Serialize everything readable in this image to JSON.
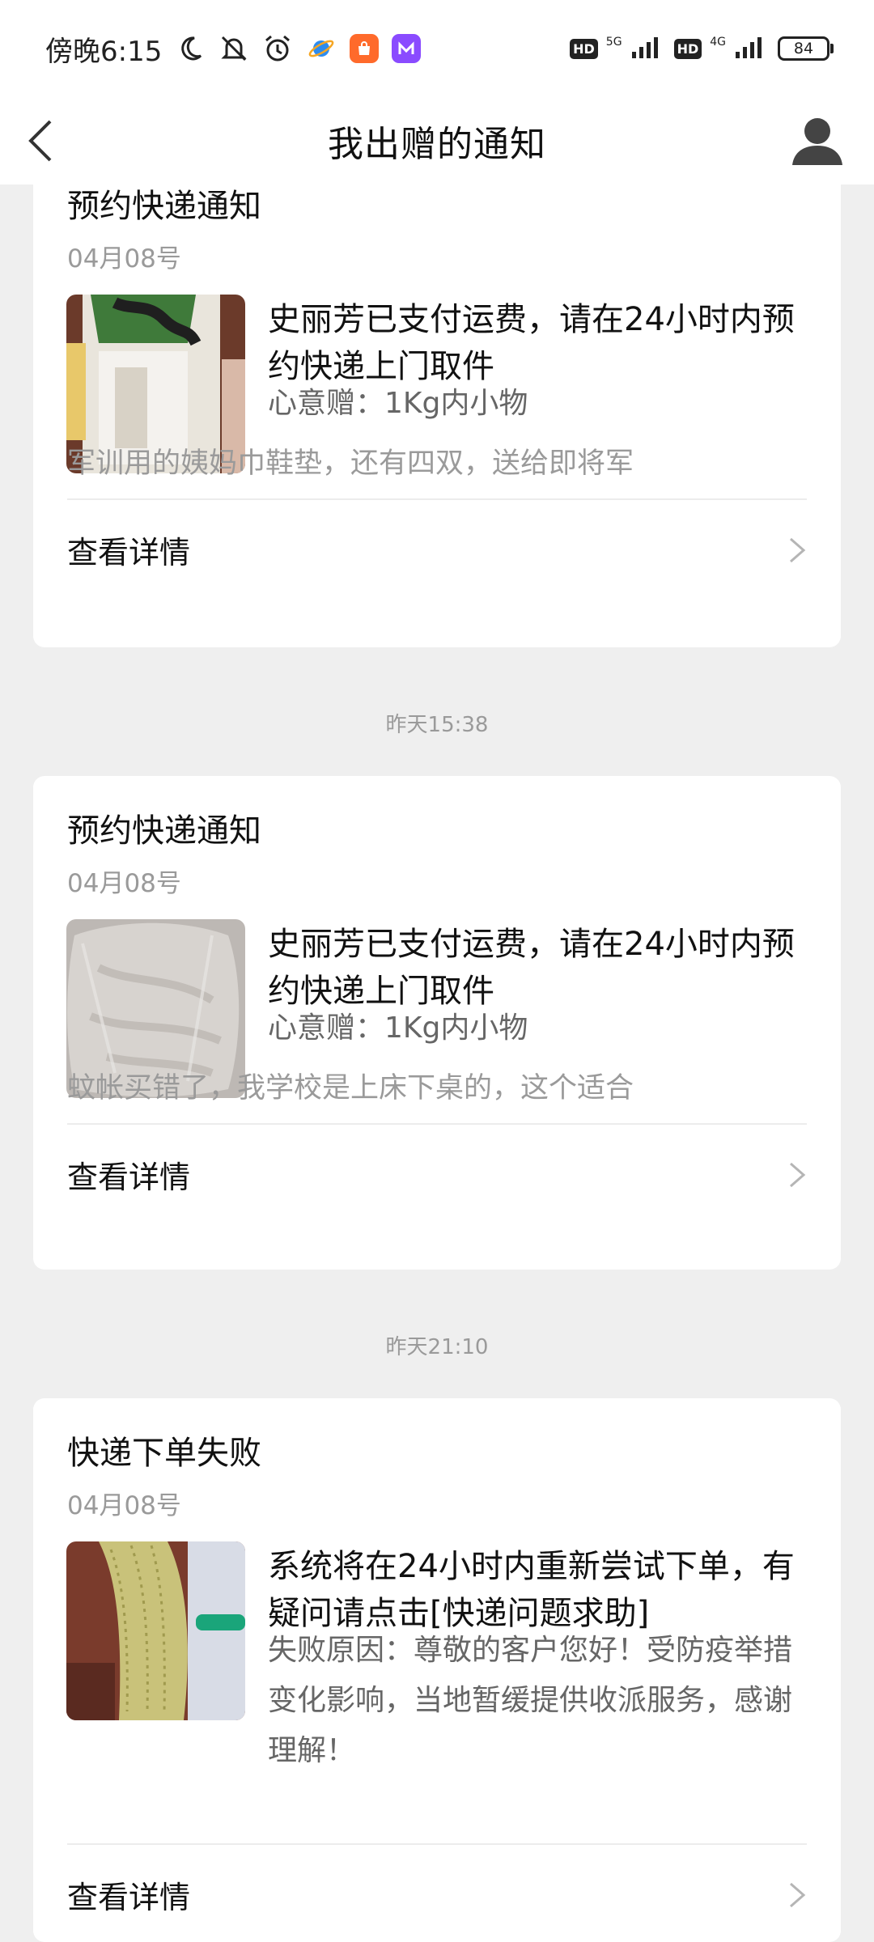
{
  "status_bar": {
    "time": "傍晚6:15",
    "network_1": "5G",
    "network_2": "4G",
    "hd": "HD",
    "battery": "84"
  },
  "header": {
    "title": "我出赠的通知"
  },
  "time_separators": [
    "昨天15:38",
    "昨天21:10"
  ],
  "cards": [
    {
      "title": "预约快递通知",
      "date": "04月08号",
      "main_text": "史丽芳已支付运费，请在24小时内预约快递上门取件",
      "sub_text": "心意赠：1Kg内小物",
      "description": "军训用的姨妈巾鞋垫，还有四双，送给即将军",
      "link_label": "查看详情"
    },
    {
      "title": "预约快递通知",
      "date": "04月08号",
      "main_text": "史丽芳已支付运费，请在24小时内预约快递上门取件",
      "sub_text": "心意赠：1Kg内小物",
      "description": "蚊帐买错了，我学校是上床下桌的，这个适合",
      "link_label": "查看详情"
    },
    {
      "title": "快递下单失败",
      "date": "04月08号",
      "main_text": "系统将在24小时内重新尝试下单，有疑问请点击[快递问题求助]",
      "sub_text": "失败原因：尊敬的客户您好！受防疫举措变化影响，当地暂缓提供收派服务，感谢理解！",
      "link_label": "查看详情"
    }
  ]
}
